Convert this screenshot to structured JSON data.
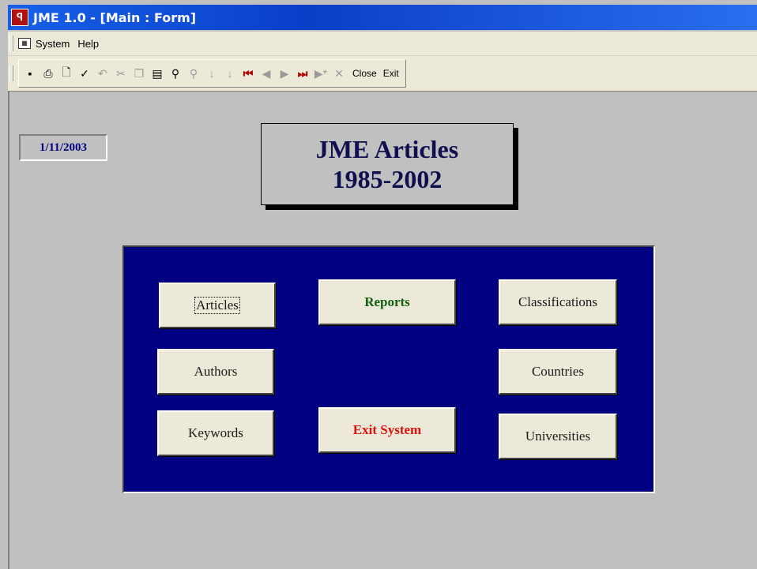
{
  "window": {
    "title": "JME 1.0 - [Main : Form]",
    "icon": "access-icon"
  },
  "menu": {
    "icon": "form-icon",
    "items": [
      "System",
      "Help"
    ]
  },
  "toolbar": {
    "icons": [
      "save-icon",
      "print-icon",
      "print-preview-icon",
      "spelling-icon",
      "undo-icon",
      "cut-icon",
      "copy-icon",
      "paste-icon",
      "find-icon",
      "find-next-icon",
      "sort-ascending-icon",
      "sort-descending-icon",
      "first-record-icon",
      "previous-record-icon",
      "next-record-icon",
      "last-record-icon",
      "new-record-icon",
      "delete-record-icon"
    ],
    "close_label": "Close",
    "exit_label": "Exit"
  },
  "form": {
    "date": "1/11/2003",
    "title_line1": "JME Articles",
    "title_line2": "1985-2002"
  },
  "buttons": {
    "articles": "Articles",
    "reports": "Reports",
    "classifications": "Classifications",
    "authors": "Authors",
    "countries": "Countries",
    "keywords": "Keywords",
    "exit_system": "Exit System",
    "universities": "Universities"
  },
  "colors": {
    "panel": "#000080",
    "reports_text": "#106010",
    "exit_text": "#e01010",
    "titlebar": "#0a3fc8"
  }
}
